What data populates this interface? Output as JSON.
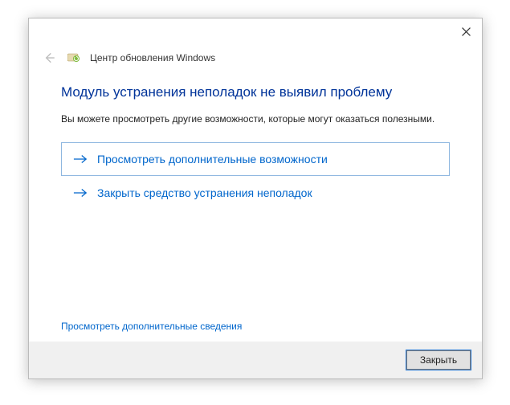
{
  "header": {
    "title": "Центр обновления Windows"
  },
  "main": {
    "heading": "Модуль устранения неполадок не выявил проблему",
    "subtext": "Вы можете просмотреть другие возможности, которые могут оказаться полезными."
  },
  "options": {
    "explore": "Просмотреть дополнительные возможности",
    "close": "Закрыть средство устранения неполадок"
  },
  "link": {
    "details": "Просмотреть дополнительные сведения"
  },
  "footer": {
    "close_button": "Закрыть"
  }
}
